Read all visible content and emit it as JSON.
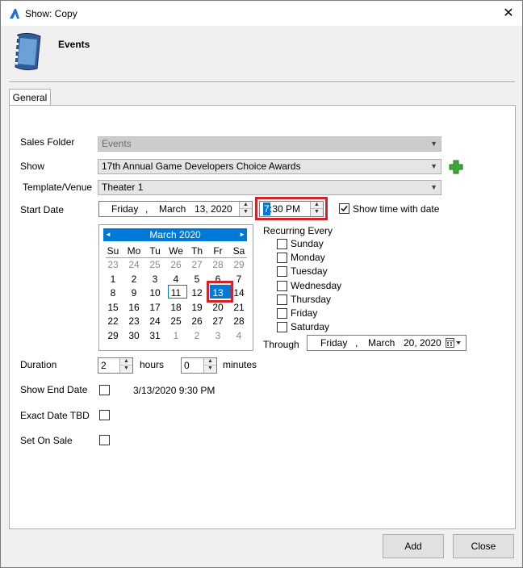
{
  "window": {
    "title": "Show: Copy",
    "close_glyph": "✕"
  },
  "header": {
    "title": "Events"
  },
  "tabs": [
    {
      "label": "General"
    }
  ],
  "form": {
    "sales_folder_label": "Sales Folder",
    "sales_folder_value": "Events",
    "show_label": "Show",
    "show_value": "17th Annual Game Developers Choice Awards",
    "template_label": "Template/Venue",
    "template_value": "Theater 1",
    "start_date_label": "Start Date",
    "start_date": {
      "weekday": "Friday",
      "comma": ",",
      "month": "March",
      "day_year": "13, 2020"
    },
    "start_time": {
      "hour": "7",
      "rest": ":30 PM"
    },
    "show_time_with_date_label": "Show time with date",
    "duration_label": "Duration",
    "duration_hours": "2",
    "hours_label": "hours",
    "duration_minutes": "0",
    "minutes_label": "minutes",
    "show_end_date_label": "Show End Date",
    "end_date_value": "3/13/2020 9:30 PM",
    "exact_date_tbd_label": "Exact Date TBD",
    "set_on_sale_label": "Set On Sale"
  },
  "calendar": {
    "month_year": "March  2020",
    "prev_glyph": "◄",
    "next_glyph": "►",
    "days_of_week": [
      "Su",
      "Mo",
      "Tu",
      "We",
      "Th",
      "Fr",
      "Sa"
    ],
    "weeks": [
      [
        "23",
        "24",
        "25",
        "26",
        "27",
        "28",
        "29"
      ],
      [
        "1",
        "2",
        "3",
        "4",
        "5",
        "6",
        "7"
      ],
      [
        "8",
        "9",
        "10",
        "11",
        "12",
        "13",
        "14"
      ],
      [
        "15",
        "16",
        "17",
        "18",
        "19",
        "20",
        "21"
      ],
      [
        "22",
        "23",
        "24",
        "25",
        "26",
        "27",
        "28"
      ],
      [
        "29",
        "30",
        "31",
        "1",
        "2",
        "3",
        "4"
      ]
    ]
  },
  "recurring": {
    "title": "Recurring Every",
    "days": [
      "Sunday",
      "Monday",
      "Tuesday",
      "Wednesday",
      "Thursday",
      "Friday",
      "Saturday"
    ],
    "through_label": "Through",
    "through_date": {
      "weekday": "Friday",
      "comma": ",",
      "month": "March",
      "day_year": "20, 2020"
    }
  },
  "buttons": {
    "add": "Add",
    "close": "Close"
  },
  "colors": {
    "accent": "#0078d7",
    "highlight_border": "#d2232a",
    "add_icon": "#3aa935"
  }
}
